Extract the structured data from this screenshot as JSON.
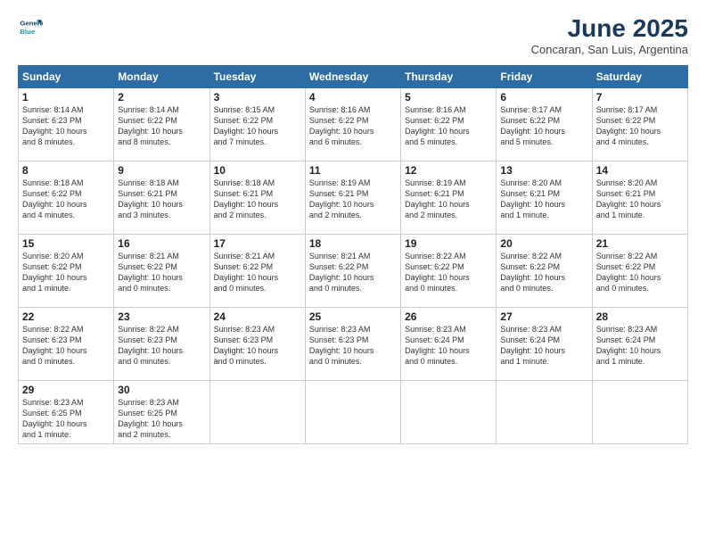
{
  "logo": {
    "line1": "General",
    "line2": "Blue"
  },
  "title": "June 2025",
  "subtitle": "Concaran, San Luis, Argentina",
  "days_of_week": [
    "Sunday",
    "Monday",
    "Tuesday",
    "Wednesday",
    "Thursday",
    "Friday",
    "Saturday"
  ],
  "weeks": [
    [
      {
        "day": "1",
        "text": "Sunrise: 8:14 AM\nSunset: 6:23 PM\nDaylight: 10 hours\nand 8 minutes."
      },
      {
        "day": "2",
        "text": "Sunrise: 8:14 AM\nSunset: 6:22 PM\nDaylight: 10 hours\nand 8 minutes."
      },
      {
        "day": "3",
        "text": "Sunrise: 8:15 AM\nSunset: 6:22 PM\nDaylight: 10 hours\nand 7 minutes."
      },
      {
        "day": "4",
        "text": "Sunrise: 8:16 AM\nSunset: 6:22 PM\nDaylight: 10 hours\nand 6 minutes."
      },
      {
        "day": "5",
        "text": "Sunrise: 8:16 AM\nSunset: 6:22 PM\nDaylight: 10 hours\nand 5 minutes."
      },
      {
        "day": "6",
        "text": "Sunrise: 8:17 AM\nSunset: 6:22 PM\nDaylight: 10 hours\nand 5 minutes."
      },
      {
        "day": "7",
        "text": "Sunrise: 8:17 AM\nSunset: 6:22 PM\nDaylight: 10 hours\nand 4 minutes."
      }
    ],
    [
      {
        "day": "8",
        "text": "Sunrise: 8:18 AM\nSunset: 6:22 PM\nDaylight: 10 hours\nand 4 minutes."
      },
      {
        "day": "9",
        "text": "Sunrise: 8:18 AM\nSunset: 6:21 PM\nDaylight: 10 hours\nand 3 minutes."
      },
      {
        "day": "10",
        "text": "Sunrise: 8:18 AM\nSunset: 6:21 PM\nDaylight: 10 hours\nand 2 minutes."
      },
      {
        "day": "11",
        "text": "Sunrise: 8:19 AM\nSunset: 6:21 PM\nDaylight: 10 hours\nand 2 minutes."
      },
      {
        "day": "12",
        "text": "Sunrise: 8:19 AM\nSunset: 6:21 PM\nDaylight: 10 hours\nand 2 minutes."
      },
      {
        "day": "13",
        "text": "Sunrise: 8:20 AM\nSunset: 6:21 PM\nDaylight: 10 hours\nand 1 minute."
      },
      {
        "day": "14",
        "text": "Sunrise: 8:20 AM\nSunset: 6:21 PM\nDaylight: 10 hours\nand 1 minute."
      }
    ],
    [
      {
        "day": "15",
        "text": "Sunrise: 8:20 AM\nSunset: 6:22 PM\nDaylight: 10 hours\nand 1 minute."
      },
      {
        "day": "16",
        "text": "Sunrise: 8:21 AM\nSunset: 6:22 PM\nDaylight: 10 hours\nand 0 minutes."
      },
      {
        "day": "17",
        "text": "Sunrise: 8:21 AM\nSunset: 6:22 PM\nDaylight: 10 hours\nand 0 minutes."
      },
      {
        "day": "18",
        "text": "Sunrise: 8:21 AM\nSunset: 6:22 PM\nDaylight: 10 hours\nand 0 minutes."
      },
      {
        "day": "19",
        "text": "Sunrise: 8:22 AM\nSunset: 6:22 PM\nDaylight: 10 hours\nand 0 minutes."
      },
      {
        "day": "20",
        "text": "Sunrise: 8:22 AM\nSunset: 6:22 PM\nDaylight: 10 hours\nand 0 minutes."
      },
      {
        "day": "21",
        "text": "Sunrise: 8:22 AM\nSunset: 6:22 PM\nDaylight: 10 hours\nand 0 minutes."
      }
    ],
    [
      {
        "day": "22",
        "text": "Sunrise: 8:22 AM\nSunset: 6:23 PM\nDaylight: 10 hours\nand 0 minutes."
      },
      {
        "day": "23",
        "text": "Sunrise: 8:22 AM\nSunset: 6:23 PM\nDaylight: 10 hours\nand 0 minutes."
      },
      {
        "day": "24",
        "text": "Sunrise: 8:23 AM\nSunset: 6:23 PM\nDaylight: 10 hours\nand 0 minutes."
      },
      {
        "day": "25",
        "text": "Sunrise: 8:23 AM\nSunset: 6:23 PM\nDaylight: 10 hours\nand 0 minutes."
      },
      {
        "day": "26",
        "text": "Sunrise: 8:23 AM\nSunset: 6:24 PM\nDaylight: 10 hours\nand 0 minutes."
      },
      {
        "day": "27",
        "text": "Sunrise: 8:23 AM\nSunset: 6:24 PM\nDaylight: 10 hours\nand 1 minute."
      },
      {
        "day": "28",
        "text": "Sunrise: 8:23 AM\nSunset: 6:24 PM\nDaylight: 10 hours\nand 1 minute."
      }
    ],
    [
      {
        "day": "29",
        "text": "Sunrise: 8:23 AM\nSunset: 6:25 PM\nDaylight: 10 hours\nand 1 minute."
      },
      {
        "day": "30",
        "text": "Sunrise: 8:23 AM\nSunset: 6:25 PM\nDaylight: 10 hours\nand 2 minutes."
      },
      {
        "day": "",
        "text": ""
      },
      {
        "day": "",
        "text": ""
      },
      {
        "day": "",
        "text": ""
      },
      {
        "day": "",
        "text": ""
      },
      {
        "day": "",
        "text": ""
      }
    ]
  ]
}
